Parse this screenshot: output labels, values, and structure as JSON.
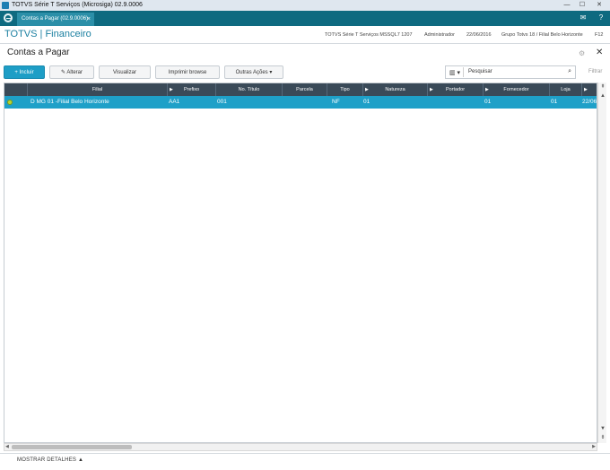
{
  "window": {
    "title": "TOTVS Série T Serviços (Microsiga) 02.9.0006",
    "min_icon": "minimize-glyph",
    "max_icon": "maximize-glyph",
    "close_icon": "close-glyph",
    "min_glyph": "—",
    "max_glyph": "☐",
    "close_glyph": "✕"
  },
  "topbar": {
    "active_tab": "Contas a Pagar (02.9.0006)",
    "tab_close": "×",
    "mail_glyph": "✉",
    "help_glyph": "?",
    "bg_color": "#0e6a80"
  },
  "module": {
    "title": "TOTVS | Financeiro",
    "environment": "TOTVS Série T Serviços MSSQL7 1207",
    "user": "Administrador",
    "date": "22/06/2016",
    "company": "Grupo Totvs 18 / Filial Belo Horizonte",
    "shortcut": "F12"
  },
  "page": {
    "title": "Contas a Pagar",
    "gear_glyph": "⚙",
    "close_glyph": "✕"
  },
  "toolbar": {
    "incluir": "+ Incluir",
    "alterar": "✎ Alterar",
    "visualizar": "Visualizar",
    "imprimir": "Imprimir browse",
    "outras": "Outras Ações ▾"
  },
  "filter": {
    "cols_glyph": "▥ ▾",
    "search_placeholder": "Pesquisar",
    "search_glyph": "⌕",
    "filtrar_label": "Filtrar"
  },
  "grid": {
    "columns": [
      "Filial",
      "Prefixo",
      "No. Título",
      "Parcela",
      "Tipo",
      "Natureza",
      "Portador",
      "Fornecedor",
      "Loja"
    ],
    "rows": [
      {
        "status": "legend-green",
        "filial": "D MG 01 -Filial Belo Horizonte",
        "prefixo": "AA1",
        "titulo": "001",
        "parcela": "",
        "tipo": "NF",
        "natureza": "01",
        "portador": "",
        "fornecedor": "01",
        "loja": "01",
        "emissao": "22/06"
      }
    ],
    "header_color": "#3a4a58",
    "row_selected_color": "#1ea0c8"
  },
  "scroll": {
    "up": "▲",
    "down": "▼",
    "top": "⇞",
    "bottom": "⇟",
    "left": "◀",
    "right": "▶"
  },
  "bottom": {
    "details_label": "MOSTRAR DETALHES ▲"
  }
}
